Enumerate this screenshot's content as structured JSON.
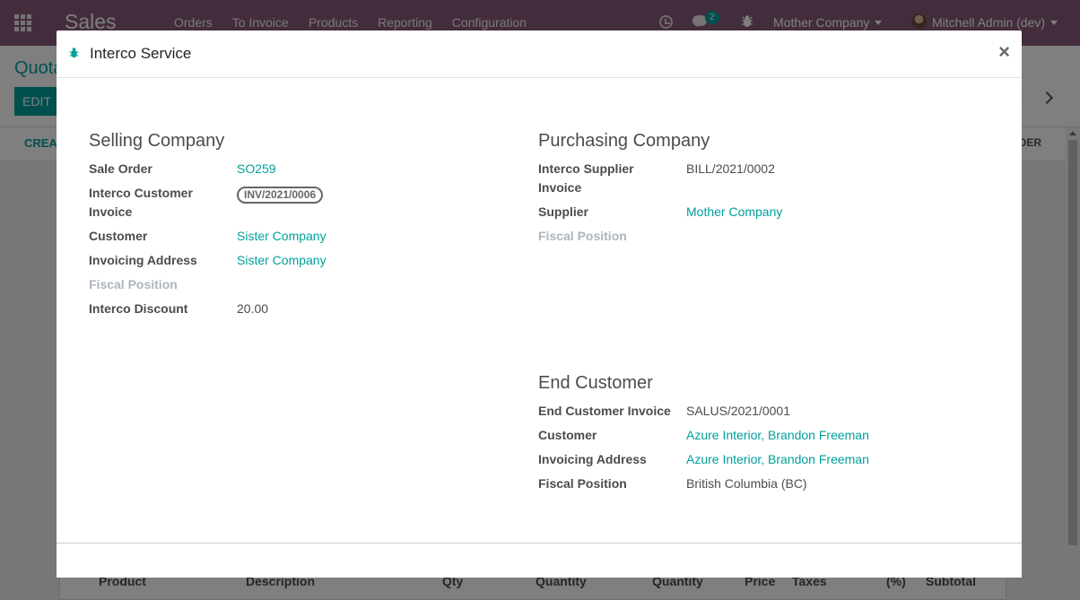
{
  "navbar": {
    "brand": "Sales",
    "menu": [
      "Orders",
      "To Invoice",
      "Products",
      "Reporting",
      "Configuration"
    ],
    "message_count": "2",
    "company": "Mother Company",
    "user": "Mitchell Admin (dev)"
  },
  "control_panel": {
    "breadcrumb": "Quota",
    "edit_label": "EDIT",
    "create_label": "CREAT",
    "order_label": "RDER"
  },
  "lines_table": {
    "headers": [
      "Product",
      "Description",
      "Qty",
      "Quantity",
      "Quantity",
      "Price",
      "Taxes",
      "(%)",
      "Subtotal"
    ]
  },
  "dialog": {
    "title": "Interco Service",
    "close": "×",
    "selling": {
      "title": "Selling Company",
      "sale_order_label": "Sale Order",
      "sale_order_value": "SO259",
      "customer_invoice_label_1": "Interco Customer",
      "customer_invoice_label_2": "Invoice",
      "customer_invoice_value": "INV/2021/0006",
      "customer_label": "Customer",
      "customer_value": "Sister Company",
      "invoicing_address_label": "Invoicing Address",
      "invoicing_address_value": "Sister Company",
      "fiscal_position_label": "Fiscal Position",
      "discount_label": "Interco Discount",
      "discount_value": "20.00"
    },
    "purchasing": {
      "title": "Purchasing Company",
      "supplier_invoice_label_1": "Interco Supplier",
      "supplier_invoice_label_2": "Invoice",
      "supplier_invoice_value": "BILL/2021/0002",
      "supplier_label": "Supplier",
      "supplier_value": "Mother Company",
      "fiscal_position_label": "Fiscal Position"
    },
    "end_customer": {
      "title": "End Customer",
      "invoice_label": "End Customer Invoice",
      "invoice_value": "SALUS/2021/0001",
      "customer_label": "Customer",
      "customer_value": "Azure Interior, Brandon Freeman",
      "invoicing_address_label": "Invoicing Address",
      "invoicing_address_value": "Azure Interior, Brandon Freeman",
      "fiscal_position_label": "Fiscal Position",
      "fiscal_position_value": "British Columbia (BC)"
    }
  },
  "colors": {
    "navbar": "#875a7b",
    "accent": "#00a09d"
  }
}
